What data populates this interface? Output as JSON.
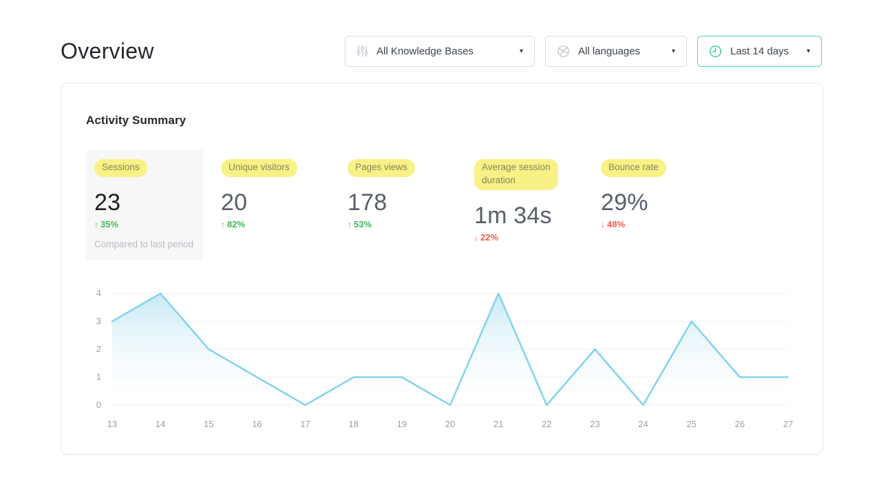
{
  "page": {
    "title": "Overview"
  },
  "filters": {
    "knowledge_bases": {
      "label": "All Knowledge Bases"
    },
    "languages": {
      "label": "All languages"
    },
    "date_range": {
      "label": "Last 14 days"
    }
  },
  "icons": {
    "caret_glyph": "▾",
    "up_arrow_glyph": "↑",
    "down_arrow_glyph": "↓"
  },
  "card": {
    "title": "Activity Summary",
    "metrics": [
      {
        "label": "Sessions",
        "value": "23",
        "delta": "35%",
        "direction": "up",
        "note": "Compared to last period",
        "selected": true
      },
      {
        "label": "Unique visitors",
        "value": "20",
        "delta": "82%",
        "direction": "up",
        "note": "",
        "selected": false
      },
      {
        "label": "Pages views",
        "value": "178",
        "delta": "53%",
        "direction": "up",
        "note": "",
        "selected": false
      },
      {
        "label": "Average session duration",
        "value": "1m 34s",
        "delta": "22%",
        "direction": "down",
        "note": "",
        "selected": false
      },
      {
        "label": "Bounce rate",
        "value": "29%",
        "delta": "48%",
        "direction": "down",
        "note": "",
        "selected": false
      }
    ]
  },
  "chart_data": {
    "type": "area",
    "title": "",
    "xlabel": "",
    "ylabel": "",
    "x": [
      13,
      14,
      15,
      16,
      17,
      18,
      19,
      20,
      21,
      22,
      23,
      24,
      25,
      26,
      27
    ],
    "values": [
      3,
      4,
      2,
      1,
      0,
      1,
      1,
      0,
      4,
      0,
      2,
      0,
      3,
      1,
      1
    ],
    "ylim": [
      0,
      4
    ],
    "yticks": [
      0,
      1,
      2,
      3,
      4
    ],
    "grid": true,
    "legend": "none"
  },
  "colors": {
    "accent": "#4cd7a9",
    "green": "#42b85c",
    "red": "#f0604e",
    "highlight": "#f8f185",
    "line": "#85d4ee",
    "fill_top": "#c3e8f5",
    "grid": "#f1f2f4",
    "tick_label": "#9aa0a8",
    "icon_gray": "#c7cbd1"
  }
}
